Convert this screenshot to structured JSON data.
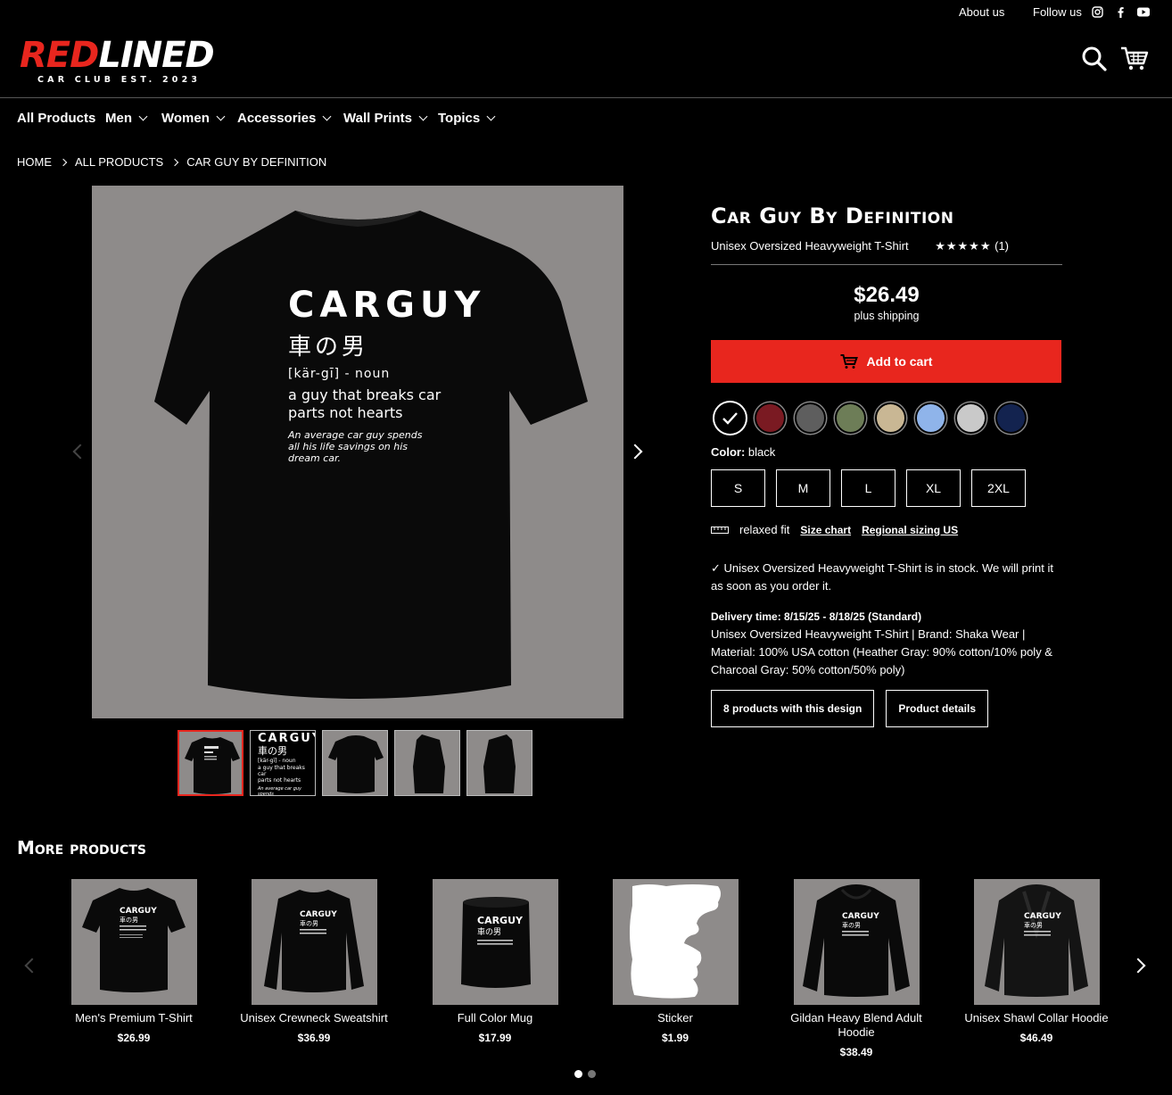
{
  "topbar": {
    "about": "About us",
    "follow": "Follow us",
    "social_icons": [
      "instagram-icon",
      "facebook-icon",
      "youtube-icon"
    ]
  },
  "logo": {
    "word_red": "RED",
    "word_white": "LINED",
    "tagline": "CAR CLUB EST. 2023"
  },
  "header_icons": [
    "search-icon",
    "cart-icon"
  ],
  "nav": [
    {
      "label": "All Products",
      "dropdown": false
    },
    {
      "label": "Men",
      "dropdown": true
    },
    {
      "label": "Women",
      "dropdown": true
    },
    {
      "label": "Accessories",
      "dropdown": true
    },
    {
      "label": "Wall Prints",
      "dropdown": true
    },
    {
      "label": "Topics",
      "dropdown": true
    }
  ],
  "breadcrumb": [
    "HOME",
    "ALL PRODUCTS",
    "CAR GUY BY DEFINITION"
  ],
  "design": {
    "word": "CARGUY",
    "kanji": "車の男",
    "phonetic": "[kär-gī] - noun",
    "definition_line1": "a guy that breaks car",
    "definition_line2": "parts not hearts",
    "note_line1": "An average car guy spends",
    "note_line2": "all his life savings on his",
    "note_line3": "dream car."
  },
  "product": {
    "title": "Car Guy By Definition",
    "subtitle": "Unisex Oversized Heavyweight T-Shirt",
    "stars": "★★★★★",
    "rating_count": "(1)",
    "price": "$26.49",
    "shipping": "plus shipping",
    "add_to_cart": "Add to cart",
    "color_label": "Color:",
    "color_value": "black",
    "sizes": [
      "S",
      "M",
      "L",
      "XL",
      "2XL"
    ],
    "fit": "relaxed fit",
    "size_chart": "Size chart",
    "regional": "Regional sizing US",
    "stock": "Unisex Oversized Heavyweight T-Shirt is in stock. We will print it as soon as you order it.",
    "delivery_label": "Delivery time: 8/15/25 - 8/18/25 (Standard)",
    "details": "Unisex Oversized Heavyweight T-Shirt | Brand: Shaka Wear | Material: 100% USA cotton (Heather Gray: 90% cotton/10% poly & Charcoal Gray: 50% cotton/50% poly)",
    "btn_design": "8 products with this design",
    "btn_details": "Product details"
  },
  "swatch_colors": [
    "#000000",
    "#7a1a22",
    "#5e5e5e",
    "#6d7d57",
    "#c9b794",
    "#8fb4ea",
    "#c9c9c9",
    "#13234f"
  ],
  "more": {
    "title": "More products",
    "items": [
      {
        "name": "Men's Premium T-Shirt",
        "price": "$26.99"
      },
      {
        "name": "Unisex Crewneck Sweatshirt",
        "price": "$36.99"
      },
      {
        "name": "Full Color Mug",
        "price": "$17.99"
      },
      {
        "name": "Sticker",
        "price": "$1.99"
      },
      {
        "name": "Gildan Heavy Blend Adult Hoodie",
        "price": "$38.49"
      },
      {
        "name": "Unisex Shawl Collar Hoodie",
        "price": "$46.49"
      }
    ]
  }
}
